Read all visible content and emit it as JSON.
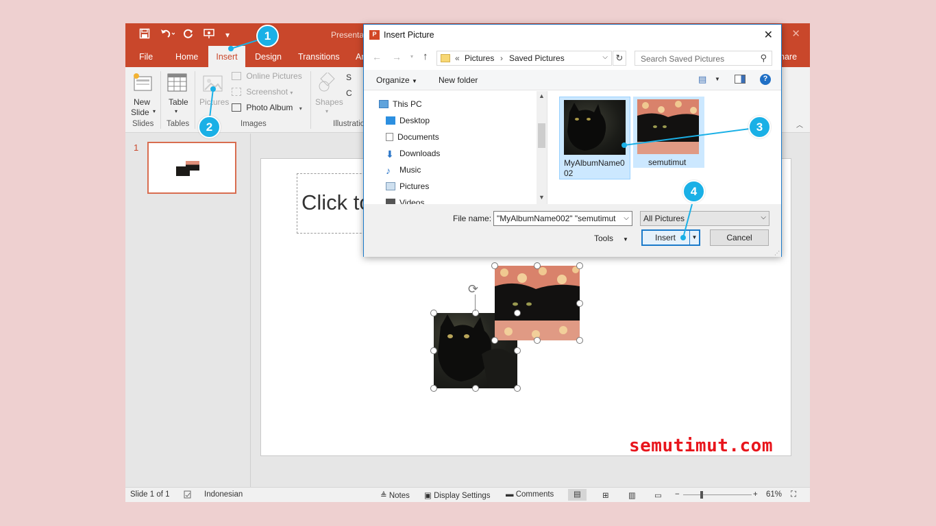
{
  "ppt": {
    "title": "Presentati",
    "tabs": [
      "File",
      "Home",
      "Insert",
      "Design",
      "Transitions",
      "An"
    ],
    "share": "hare",
    "ribbon": {
      "new_slide": "New",
      "new_slide_2": "Slide",
      "table": "Table",
      "pictures": "Pictures",
      "online_pictures": "Online Pictures",
      "screenshot": "Screenshot",
      "photo_album": "Photo Album",
      "shapes": "Shapes",
      "sm": "S",
      "ch": "C",
      "groups": {
        "slides": "Slides",
        "tables": "Tables",
        "images": "Images",
        "illustrations": "Illustratio"
      }
    },
    "slide_number": "1",
    "placeholder_text": "Click to",
    "status": {
      "slide": "Slide 1 of 1",
      "language": "Indonesian",
      "notes": "Notes",
      "display_settings": "Display Settings",
      "comments": "Comments",
      "zoom": "61%"
    }
  },
  "dialog": {
    "title": "Insert Picture",
    "app_icon": "P",
    "breadcrumb": {
      "prefix": "«",
      "part1": "Pictures",
      "sep": "›",
      "part2": "Saved Pictures"
    },
    "search_placeholder": "Search Saved Pictures",
    "organize": "Organize",
    "new_folder": "New folder",
    "tree": [
      "This PC",
      "Desktop",
      "Documents",
      "Downloads",
      "Music",
      "Pictures",
      "Videos"
    ],
    "files": [
      {
        "name_line1": "MyAlbumName0",
        "name_line2": "02"
      },
      {
        "name_line1": "semutimut",
        "name_line2": ""
      }
    ],
    "file_name_label": "File name:",
    "file_name_value": "\"MyAlbumName002\" \"semutimut",
    "filter_value": "All Pictures",
    "tools": "Tools",
    "insert": "Insert",
    "cancel": "Cancel"
  },
  "badges": [
    "1",
    "2",
    "3",
    "4"
  ],
  "watermark": "semutimut.com",
  "colors": {
    "ppt_accent": "#c9472b",
    "badge": "#1ab0e6",
    "dialog_border": "#1979ca",
    "watermark": "#e8151c"
  }
}
